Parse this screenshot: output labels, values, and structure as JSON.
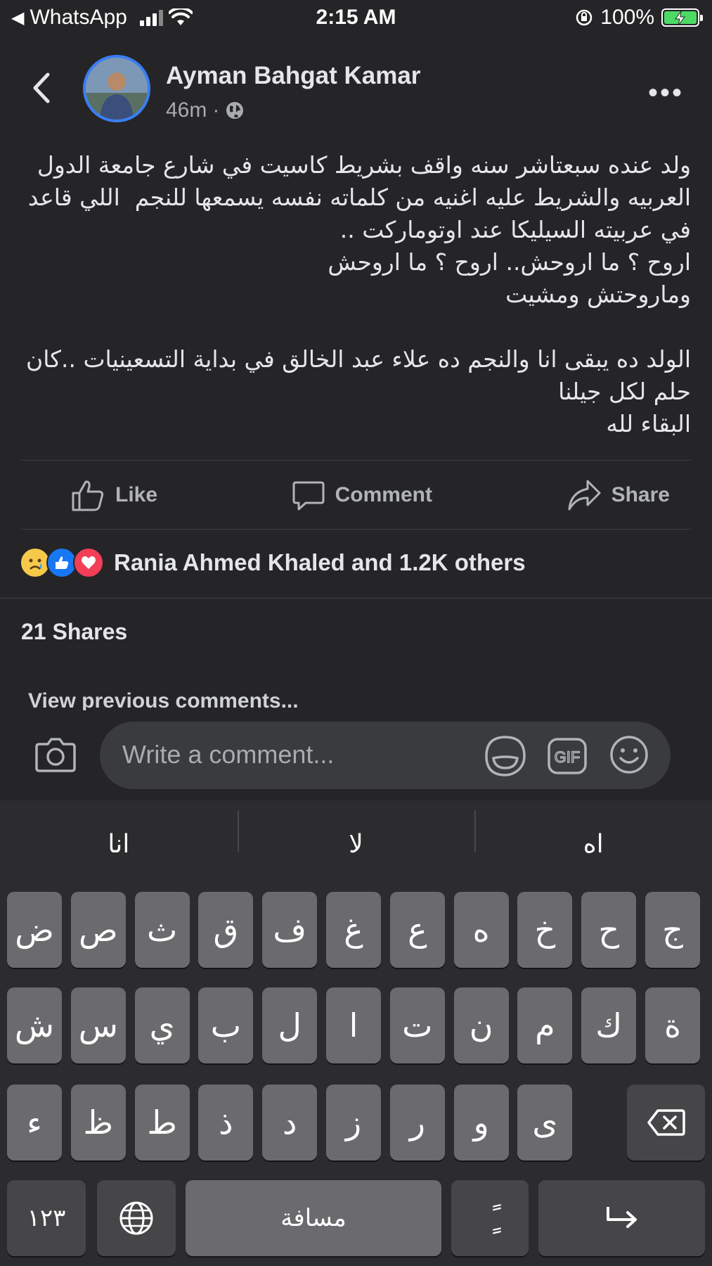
{
  "status_bar": {
    "back_app": "WhatsApp",
    "time": "2:15 AM",
    "battery": "100%"
  },
  "post": {
    "author": "Ayman Bahgat Kamar",
    "time": "46m",
    "text": "ولد عنده سبعتاشر سنه واقف بشريط كاسيت في شارع جامعة الدول العربيه والشريط عليه اغنيه من كلماته نفسه يسمعها للنجم  اللي قاعد في عربيته السيليكا عند اوتوماركت ..\nاروح ؟ ما اروحش.. اروح ؟ ما اروحش\nوماروحتش ومشيت\n\nالولد ده يبقى انا والنجم ده علاء عبد الخالق في بداية التسعينيات ..كان حلم لكل جيلنا\nالبقاء لله"
  },
  "actions": {
    "like": "Like",
    "comment": "Comment",
    "share": "Share"
  },
  "reactions": {
    "icons": [
      "sad-emoji",
      "like-thumb",
      "love-heart"
    ],
    "summary": "Rania Ahmed Khaled and 1.2K others"
  },
  "shares": "21 Shares",
  "view_previous": "View previous comments...",
  "comment_input": {
    "placeholder": "Write a comment..."
  },
  "keyboard": {
    "suggestions": [
      "انا",
      "لا",
      "اه"
    ],
    "row1": [
      "ض",
      "ص",
      "ث",
      "ق",
      "ف",
      "غ",
      "ع",
      "ه",
      "خ",
      "ح",
      "ج"
    ],
    "row2": [
      "ش",
      "س",
      "ي",
      "ب",
      "ل",
      "ا",
      "ت",
      "ن",
      "م",
      "ك",
      "ة"
    ],
    "row3": [
      "ء",
      "ظ",
      "ط",
      "ذ",
      "د",
      "ز",
      "ر",
      "و",
      "ى"
    ],
    "numbers_key": "١٢٣",
    "space_key": "مسافة",
    "diacritic_key": "ًٍ"
  },
  "colors": {
    "background": "#252527",
    "avatar_ring": "#3a7ef5",
    "battery_fill": "#4cd964",
    "like_blue": "#1877f2",
    "love_red": "#f33e58"
  }
}
